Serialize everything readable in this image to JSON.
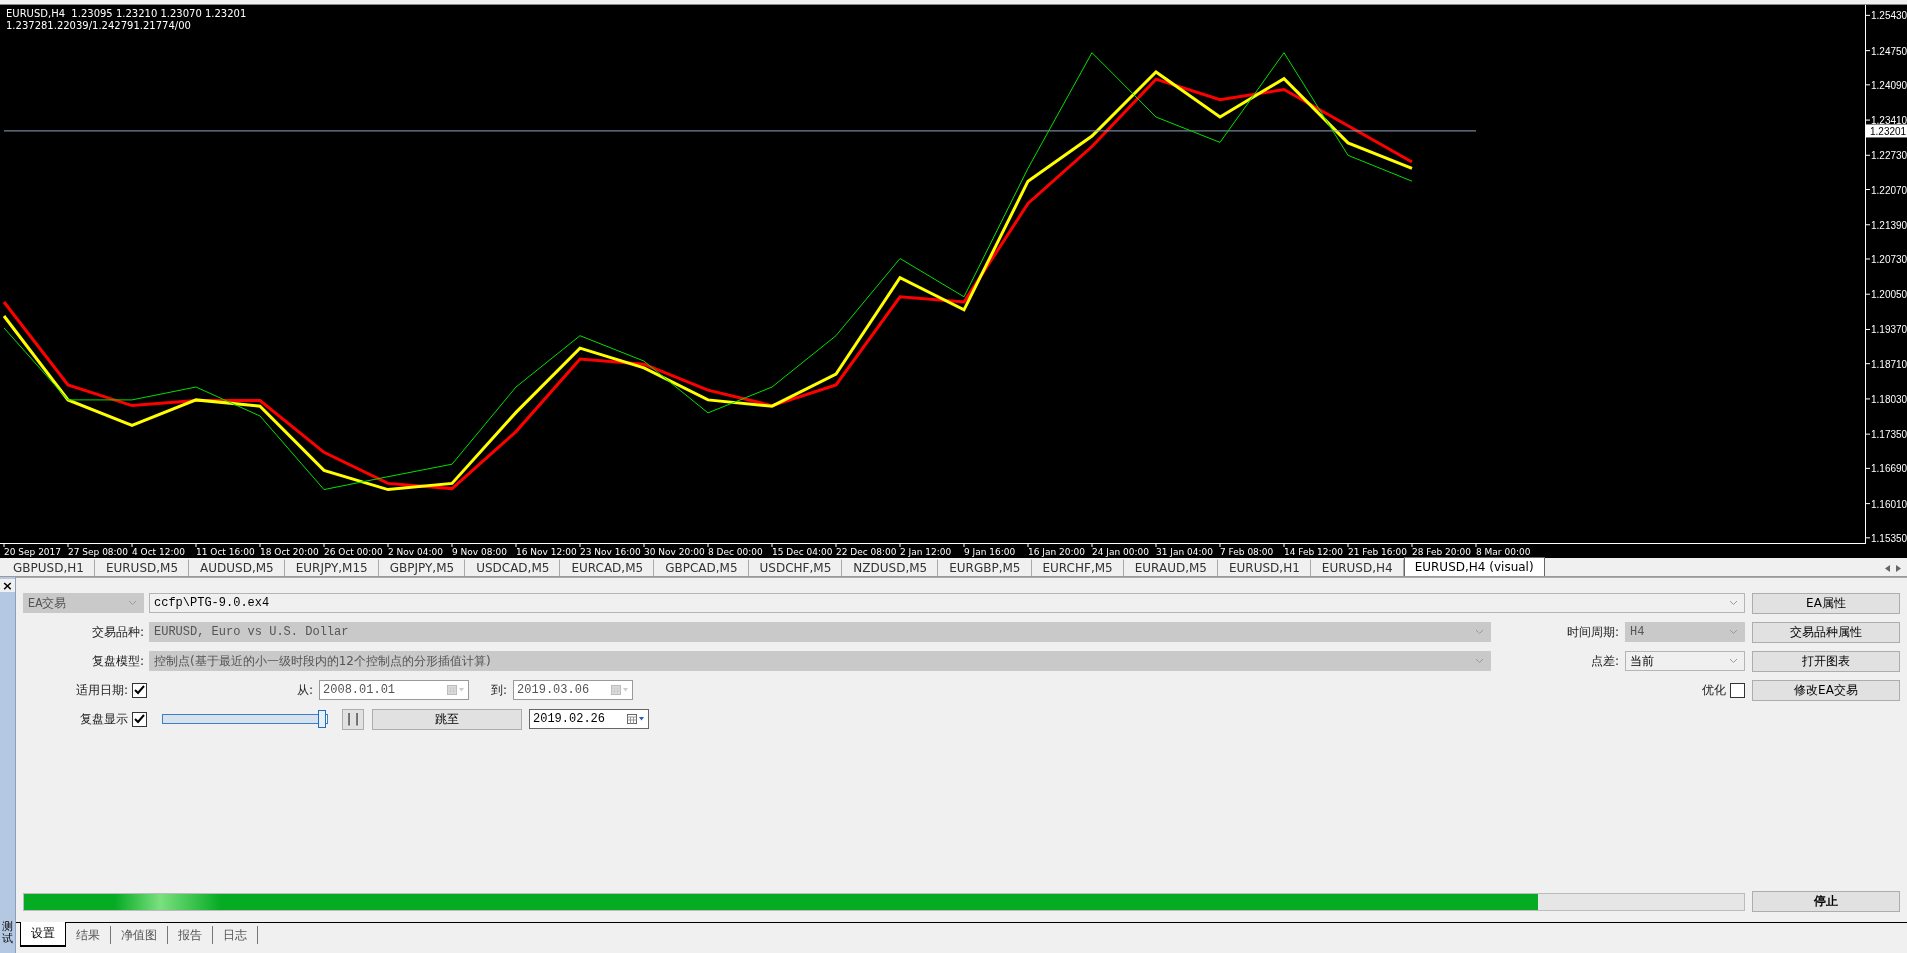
{
  "chart": {
    "price_label": "1.23201",
    "header": [
      "EURUSD,H4  1.23095 1.23210 1.23070 1.23201",
      "1.237281.22039/1.242791.21774/00"
    ],
    "chart_data": {
      "type": "line",
      "x": [
        "20 Sep 2017",
        "27 Sep 08:00",
        "4 Oct 12:00",
        "11 Oct 16:00",
        "18 Oct 20:00",
        "26 Oct 00:00",
        "2 Nov 04:00",
        "9 Nov 08:00",
        "16 Nov 12:00",
        "23 Nov 16:00",
        "30 Nov 20:00",
        "8 Dec 00:00",
        "15 Dec 04:00",
        "22 Dec 08:00",
        "2 Jan 12:00",
        "9 Jan 16:00",
        "16 Jan 20:00",
        "24 Jan 00:00",
        "31 Jan 04:00",
        "7 Feb 08:00",
        "14 Feb 12:00",
        "21 Feb 16:00",
        "28 Feb 20:00",
        "8 Mar 00:00"
      ],
      "series": [
        {
          "color": "#00e000",
          "values": [
            1.194,
            1.1801,
            1.1801,
            1.1826,
            1.177,
            1.1628,
            1.1653,
            1.1677,
            1.1826,
            1.1925,
            1.1876,
            1.1776,
            1.1826,
            1.1925,
            1.2074,
            1.2,
            1.2248,
            1.2471,
            1.2347,
            1.2298,
            1.2471,
            1.2273,
            1.2223,
            null
          ]
        },
        {
          "color": "#ff0000",
          "values": [
            1.199,
            1.183,
            1.179,
            1.18,
            1.18,
            1.17,
            1.164,
            1.163,
            1.174,
            1.188,
            1.187,
            1.182,
            1.179,
            1.183,
            1.2,
            1.199,
            1.218,
            1.229,
            1.242,
            1.238,
            1.24,
            1.233,
            1.226,
            null
          ]
        },
        {
          "color": "#ffff00",
          "values": [
            1.1963,
            1.1801,
            1.1752,
            1.1801,
            1.1789,
            1.1665,
            1.1628,
            1.164,
            1.1777,
            1.1901,
            1.1863,
            1.1801,
            1.1789,
            1.1851,
            1.2037,
            1.1975,
            1.2223,
            1.231,
            1.2434,
            1.2347,
            1.2421,
            1.2297,
            1.2248,
            null
          ]
        },
        {
          "color": "#8da3c0",
          "values": [
            1.232,
            1.232,
            1.232,
            1.232,
            1.232,
            1.232,
            1.232,
            1.232,
            1.232,
            1.232,
            1.232,
            1.232,
            1.232,
            1.232,
            1.232,
            1.232,
            1.232,
            1.232,
            1.232,
            1.232,
            1.232,
            1.232,
            1.232,
            1.232
          ]
        }
      ],
      "ylim": [
        1.1525,
        1.2563
      ],
      "yticks": [
        {
          "value": 1.2543,
          "label": "1.25430"
        },
        {
          "value": 1.2475,
          "label": "1.24750"
        },
        {
          "value": 1.2409,
          "label": "1.24090"
        },
        {
          "value": 1.2341,
          "label": "1.23410"
        },
        {
          "value": 1.2273,
          "label": "1.22730"
        },
        {
          "value": 1.2207,
          "label": "1.22070"
        },
        {
          "value": 1.2139,
          "label": "1.21390"
        },
        {
          "value": 1.2073,
          "label": "1.20730"
        },
        {
          "value": 1.2005,
          "label": "1.20050"
        },
        {
          "value": 1.1937,
          "label": "1.19370"
        },
        {
          "value": 1.1871,
          "label": "1.18710"
        },
        {
          "value": 1.1803,
          "label": "1.18030"
        },
        {
          "value": 1.1735,
          "label": "1.17350"
        },
        {
          "value": 1.1669,
          "label": "1.16690"
        },
        {
          "value": 1.1601,
          "label": "1.16010"
        },
        {
          "value": 1.1535,
          "label": "1.15350"
        }
      ]
    }
  },
  "symbol_tabs": [
    {
      "label": "GBPUSD,H1",
      "selected": false
    },
    {
      "label": "EURUSD,M5",
      "selected": false
    },
    {
      "label": "AUDUSD,M5",
      "selected": false
    },
    {
      "label": "EURJPY,M15",
      "selected": false
    },
    {
      "label": "GBPJPY,M5",
      "selected": false
    },
    {
      "label": "USDCAD,M5",
      "selected": false
    },
    {
      "label": "EURCAD,M5",
      "selected": false
    },
    {
      "label": "GBPCAD,M5",
      "selected": false
    },
    {
      "label": "USDCHF,M5",
      "selected": false
    },
    {
      "label": "NZDUSD,M5",
      "selected": false
    },
    {
      "label": "EURGBP,M5",
      "selected": false
    },
    {
      "label": "EURCHF,M5",
      "selected": false
    },
    {
      "label": "EURAUD,M5",
      "selected": false
    },
    {
      "label": "EURUSD,H1",
      "selected": false
    },
    {
      "label": "EURUSD,H4",
      "selected": false
    },
    {
      "label": "EURUSD,H4 (visual)",
      "selected": true
    }
  ],
  "panel": {
    "close": "×",
    "title": "测试"
  },
  "settings": {
    "expert": {
      "value": "EA交易",
      "disabled": true
    },
    "expert_file": {
      "value": "ccfp\\PTG-9.0.ex4",
      "disabled": false
    },
    "symbol": {
      "label": "交易品种:",
      "value": "EURUSD, Euro vs U.S. Dollar",
      "disabled": true
    },
    "period": {
      "label": "时间周期:",
      "value": "H4",
      "disabled": true
    },
    "model": {
      "label": "复盘模型:",
      "value": "控制点(基于最近的小一级时段内的12个控制点的分形插值计算)",
      "disabled": true
    },
    "spread": {
      "label": "点差:",
      "value": "当前",
      "disabled": false
    },
    "use_date": {
      "label": "适用日期:",
      "checked": true
    },
    "from": {
      "label": "从:",
      "value": "2008.01.01",
      "disabled": true
    },
    "to": {
      "label": "到:",
      "value": "2019.03.06",
      "disabled": true
    },
    "optimization": {
      "label": "优化",
      "checked": false
    },
    "visual": {
      "label": "复盘显示",
      "checked": true
    },
    "speed": {
      "level": 0.97
    },
    "pause": "| |",
    "skip_to": "跳至",
    "skip_date": {
      "value": "2019.02.26",
      "disabled": false
    }
  },
  "buttons": [
    "EA属性",
    "交易品种属性",
    "打开图表",
    "修改EA交易"
  ],
  "progress": {
    "level": 0.88
  },
  "stop": "停止",
  "bottom_tabs": [
    {
      "label": "设置",
      "selected": true
    },
    {
      "label": "结果",
      "selected": false
    },
    {
      "label": "净值图",
      "selected": false
    },
    {
      "label": "报告",
      "selected": false
    },
    {
      "label": "日志",
      "selected": false
    }
  ]
}
